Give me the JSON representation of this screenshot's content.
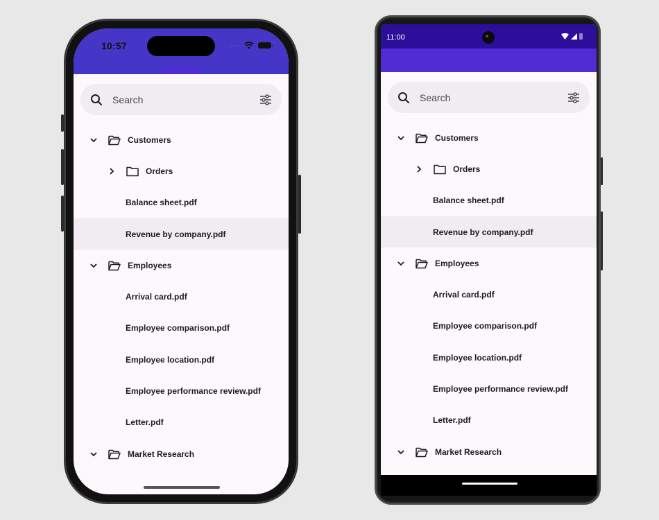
{
  "devices": [
    {
      "platform": "iOS",
      "status_bar": {
        "time": "10:57"
      },
      "search": {
        "placeholder": "Search"
      },
      "tree": [
        {
          "type": "folder",
          "level": 0,
          "label": "Customers",
          "expanded": true,
          "open_icon": true
        },
        {
          "type": "folder",
          "level": 1,
          "label": "Orders",
          "expanded": false,
          "open_icon": false
        },
        {
          "type": "file",
          "level": 1,
          "label": "Balance sheet.pdf"
        },
        {
          "type": "file",
          "level": 1,
          "label": "Revenue by company.pdf",
          "selected": true
        },
        {
          "type": "folder",
          "level": 0,
          "label": "Employees",
          "expanded": true,
          "open_icon": true
        },
        {
          "type": "file",
          "level": 1,
          "label": "Arrival card.pdf"
        },
        {
          "type": "file",
          "level": 1,
          "label": "Employee comparison.pdf"
        },
        {
          "type": "file",
          "level": 1,
          "label": "Employee location.pdf"
        },
        {
          "type": "file",
          "level": 1,
          "label": "Employee performance review.pdf"
        },
        {
          "type": "file",
          "level": 1,
          "label": "Letter.pdf"
        },
        {
          "type": "folder",
          "level": 0,
          "label": "Market Research",
          "expanded": true,
          "open_icon": true
        }
      ]
    },
    {
      "platform": "Android",
      "status_bar": {
        "time": "11:00"
      },
      "search": {
        "placeholder": "Search"
      },
      "tree": [
        {
          "type": "folder",
          "level": 0,
          "label": "Customers",
          "expanded": true,
          "open_icon": true
        },
        {
          "type": "folder",
          "level": 1,
          "label": "Orders",
          "expanded": false,
          "open_icon": false
        },
        {
          "type": "file",
          "level": 1,
          "label": "Balance sheet.pdf"
        },
        {
          "type": "file",
          "level": 1,
          "label": "Revenue by company.pdf",
          "selected": true
        },
        {
          "type": "folder",
          "level": 0,
          "label": "Employees",
          "expanded": true,
          "open_icon": true
        },
        {
          "type": "file",
          "level": 1,
          "label": "Arrival card.pdf"
        },
        {
          "type": "file",
          "level": 1,
          "label": "Employee comparison.pdf"
        },
        {
          "type": "file",
          "level": 1,
          "label": "Employee location.pdf"
        },
        {
          "type": "file",
          "level": 1,
          "label": "Employee performance review.pdf"
        },
        {
          "type": "file",
          "level": 1,
          "label": "Letter.pdf"
        },
        {
          "type": "folder",
          "level": 0,
          "label": "Market Research",
          "expanded": true,
          "open_icon": true
        }
      ]
    }
  ],
  "colors": {
    "ios_app_bar": "#4636c8",
    "android_status_bar": "#2b0f9a",
    "android_app_bar": "#512bd4",
    "surface": "#fcf8fc",
    "search_bg": "#f1ecf1",
    "selected_row": "#f1ecf1",
    "text": "#1c1b1f"
  }
}
